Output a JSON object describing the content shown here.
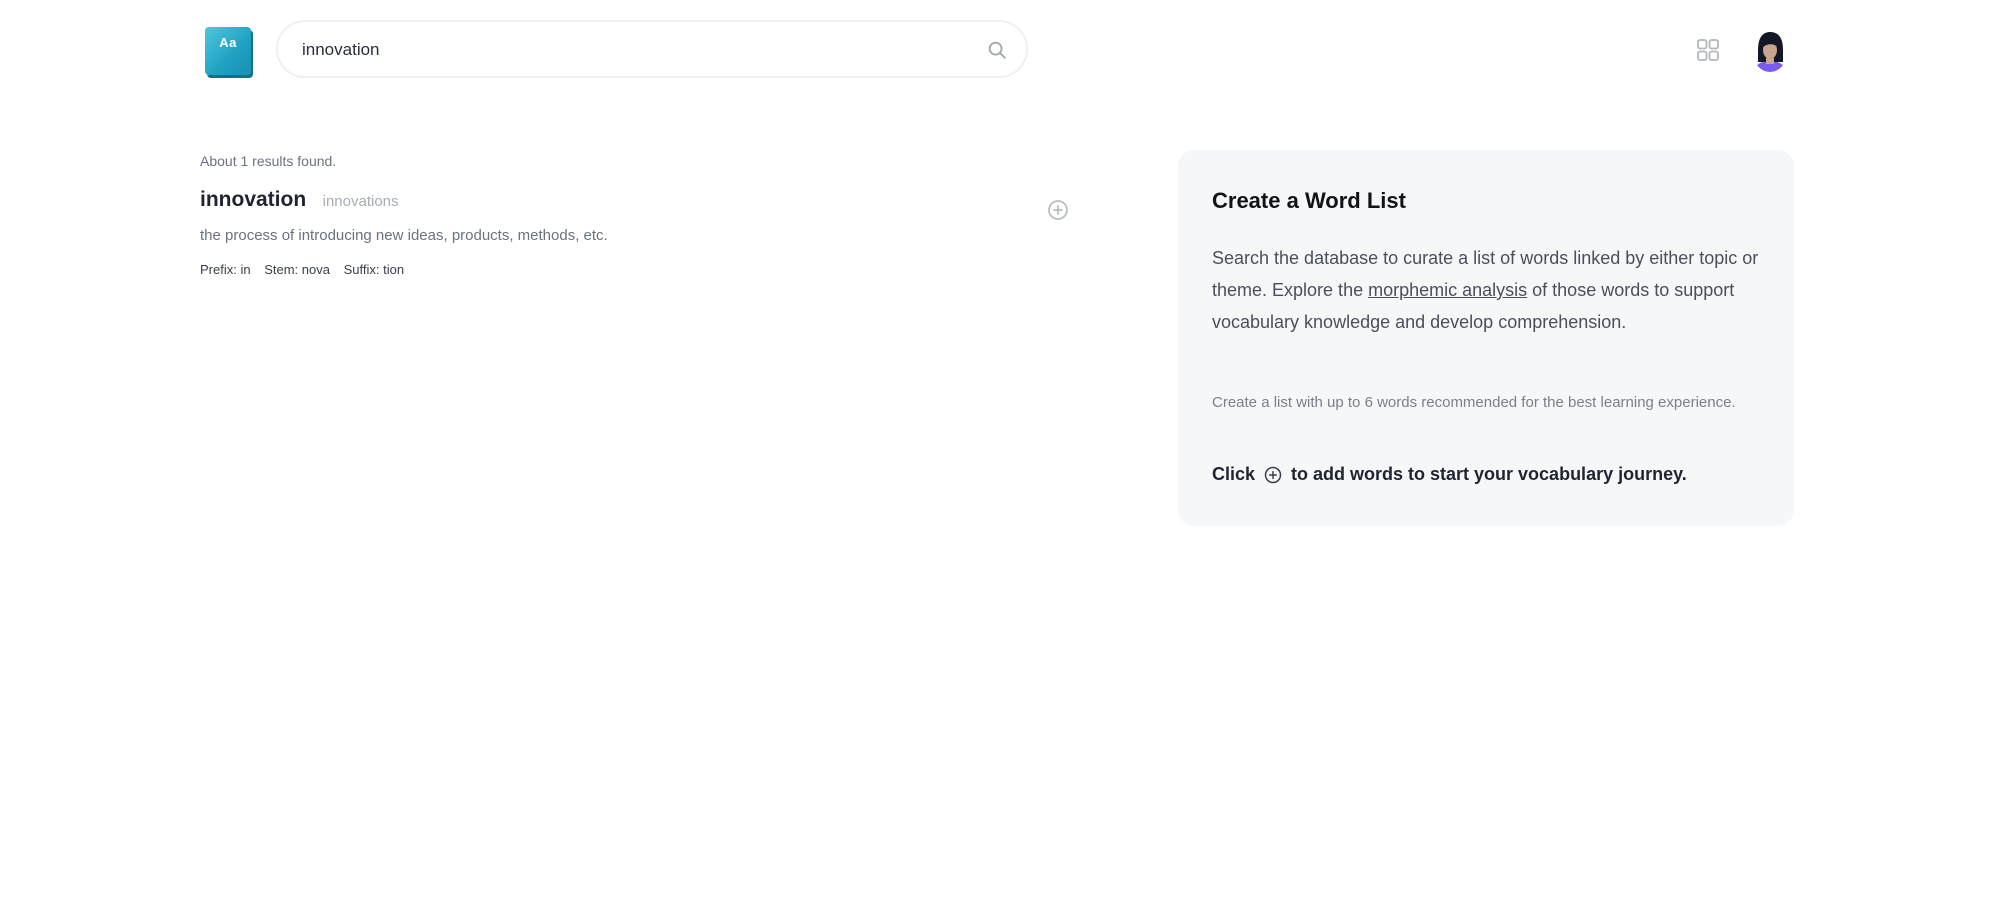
{
  "header": {
    "logo_text": "Aa",
    "search": {
      "value": "innovation",
      "placeholder": ""
    },
    "icons": {
      "search": "search-icon",
      "apps": "grid-icon",
      "profile": "avatar"
    }
  },
  "results": {
    "count_text": "About 1 results found.",
    "items": [
      {
        "word": "innovation",
        "plural": "innovations",
        "definition": "the process of introducing new ideas, products, methods, etc.",
        "morphemes": {
          "prefix": "Prefix: in",
          "stem": "Stem: nova",
          "suffix": "Suffix: tion"
        }
      }
    ]
  },
  "info_card": {
    "title": "Create a Word List",
    "description_before": "Search the database to curate a list of words linked by either topic or theme. Explore the ",
    "description_link": "morphemic analysis",
    "description_after": " of those words to support vocabulary knowledge and develop comprehension.",
    "note": "Create a list with up to 6 words recommended for the best learning experience.",
    "cta_before": "Click",
    "cta_after": "to add words to start your vocabulary journey."
  },
  "colors": {
    "logo": "#1fa1c2",
    "card_background": "#f6f7f9",
    "text_primary": "#1f2430",
    "text_muted": "#6b7280"
  }
}
